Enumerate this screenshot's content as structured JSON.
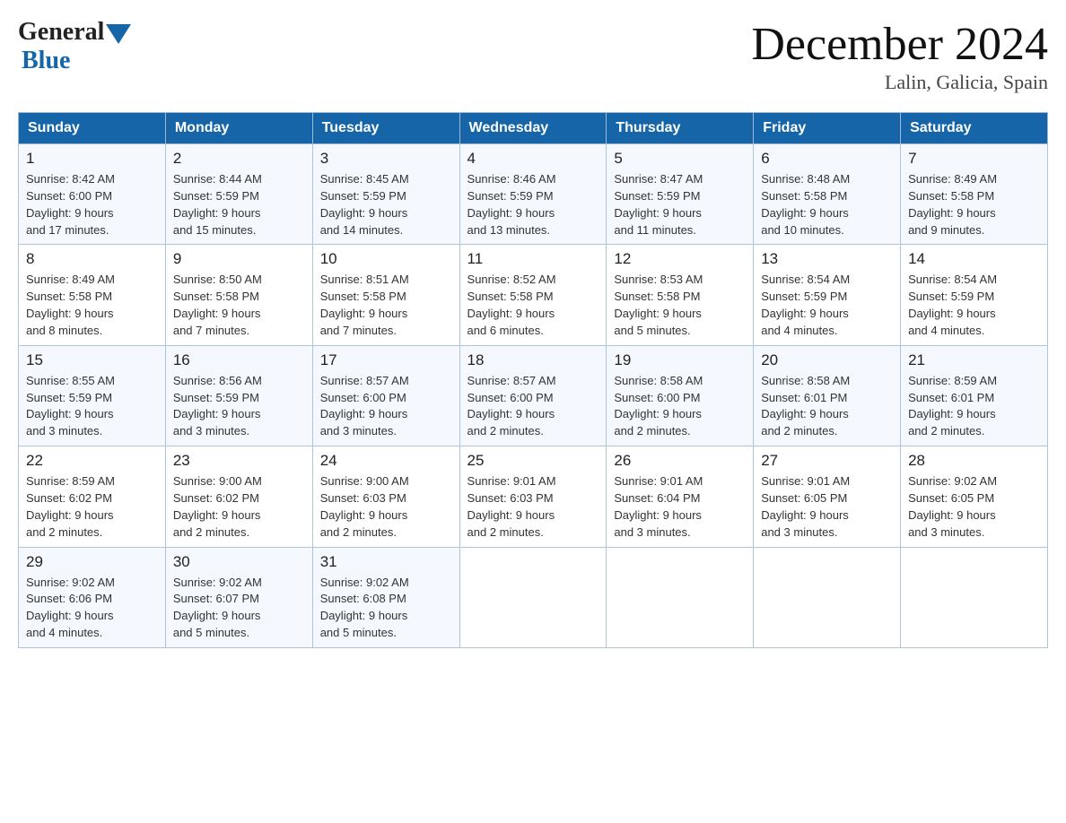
{
  "header": {
    "logo_general": "General",
    "logo_blue": "Blue",
    "title": "December 2024",
    "subtitle": "Lalin, Galicia, Spain"
  },
  "days_of_week": [
    "Sunday",
    "Monday",
    "Tuesday",
    "Wednesday",
    "Thursday",
    "Friday",
    "Saturday"
  ],
  "weeks": [
    [
      {
        "day": "1",
        "sunrise": "8:42 AM",
        "sunset": "6:00 PM",
        "daylight": "9 hours and 17 minutes."
      },
      {
        "day": "2",
        "sunrise": "8:44 AM",
        "sunset": "5:59 PM",
        "daylight": "9 hours and 15 minutes."
      },
      {
        "day": "3",
        "sunrise": "8:45 AM",
        "sunset": "5:59 PM",
        "daylight": "9 hours and 14 minutes."
      },
      {
        "day": "4",
        "sunrise": "8:46 AM",
        "sunset": "5:59 PM",
        "daylight": "9 hours and 13 minutes."
      },
      {
        "day": "5",
        "sunrise": "8:47 AM",
        "sunset": "5:59 PM",
        "daylight": "9 hours and 11 minutes."
      },
      {
        "day": "6",
        "sunrise": "8:48 AM",
        "sunset": "5:58 PM",
        "daylight": "9 hours and 10 minutes."
      },
      {
        "day": "7",
        "sunrise": "8:49 AM",
        "sunset": "5:58 PM",
        "daylight": "9 hours and 9 minutes."
      }
    ],
    [
      {
        "day": "8",
        "sunrise": "8:49 AM",
        "sunset": "5:58 PM",
        "daylight": "9 hours and 8 minutes."
      },
      {
        "day": "9",
        "sunrise": "8:50 AM",
        "sunset": "5:58 PM",
        "daylight": "9 hours and 7 minutes."
      },
      {
        "day": "10",
        "sunrise": "8:51 AM",
        "sunset": "5:58 PM",
        "daylight": "9 hours and 7 minutes."
      },
      {
        "day": "11",
        "sunrise": "8:52 AM",
        "sunset": "5:58 PM",
        "daylight": "9 hours and 6 minutes."
      },
      {
        "day": "12",
        "sunrise": "8:53 AM",
        "sunset": "5:58 PM",
        "daylight": "9 hours and 5 minutes."
      },
      {
        "day": "13",
        "sunrise": "8:54 AM",
        "sunset": "5:59 PM",
        "daylight": "9 hours and 4 minutes."
      },
      {
        "day": "14",
        "sunrise": "8:54 AM",
        "sunset": "5:59 PM",
        "daylight": "9 hours and 4 minutes."
      }
    ],
    [
      {
        "day": "15",
        "sunrise": "8:55 AM",
        "sunset": "5:59 PM",
        "daylight": "9 hours and 3 minutes."
      },
      {
        "day": "16",
        "sunrise": "8:56 AM",
        "sunset": "5:59 PM",
        "daylight": "9 hours and 3 minutes."
      },
      {
        "day": "17",
        "sunrise": "8:57 AM",
        "sunset": "6:00 PM",
        "daylight": "9 hours and 3 minutes."
      },
      {
        "day": "18",
        "sunrise": "8:57 AM",
        "sunset": "6:00 PM",
        "daylight": "9 hours and 2 minutes."
      },
      {
        "day": "19",
        "sunrise": "8:58 AM",
        "sunset": "6:00 PM",
        "daylight": "9 hours and 2 minutes."
      },
      {
        "day": "20",
        "sunrise": "8:58 AM",
        "sunset": "6:01 PM",
        "daylight": "9 hours and 2 minutes."
      },
      {
        "day": "21",
        "sunrise": "8:59 AM",
        "sunset": "6:01 PM",
        "daylight": "9 hours and 2 minutes."
      }
    ],
    [
      {
        "day": "22",
        "sunrise": "8:59 AM",
        "sunset": "6:02 PM",
        "daylight": "9 hours and 2 minutes."
      },
      {
        "day": "23",
        "sunrise": "9:00 AM",
        "sunset": "6:02 PM",
        "daylight": "9 hours and 2 minutes."
      },
      {
        "day": "24",
        "sunrise": "9:00 AM",
        "sunset": "6:03 PM",
        "daylight": "9 hours and 2 minutes."
      },
      {
        "day": "25",
        "sunrise": "9:01 AM",
        "sunset": "6:03 PM",
        "daylight": "9 hours and 2 minutes."
      },
      {
        "day": "26",
        "sunrise": "9:01 AM",
        "sunset": "6:04 PM",
        "daylight": "9 hours and 3 minutes."
      },
      {
        "day": "27",
        "sunrise": "9:01 AM",
        "sunset": "6:05 PM",
        "daylight": "9 hours and 3 minutes."
      },
      {
        "day": "28",
        "sunrise": "9:02 AM",
        "sunset": "6:05 PM",
        "daylight": "9 hours and 3 minutes."
      }
    ],
    [
      {
        "day": "29",
        "sunrise": "9:02 AM",
        "sunset": "6:06 PM",
        "daylight": "9 hours and 4 minutes."
      },
      {
        "day": "30",
        "sunrise": "9:02 AM",
        "sunset": "6:07 PM",
        "daylight": "9 hours and 5 minutes."
      },
      {
        "day": "31",
        "sunrise": "9:02 AM",
        "sunset": "6:08 PM",
        "daylight": "9 hours and 5 minutes."
      },
      null,
      null,
      null,
      null
    ]
  ],
  "labels": {
    "sunrise": "Sunrise:",
    "sunset": "Sunset:",
    "daylight": "Daylight:"
  }
}
